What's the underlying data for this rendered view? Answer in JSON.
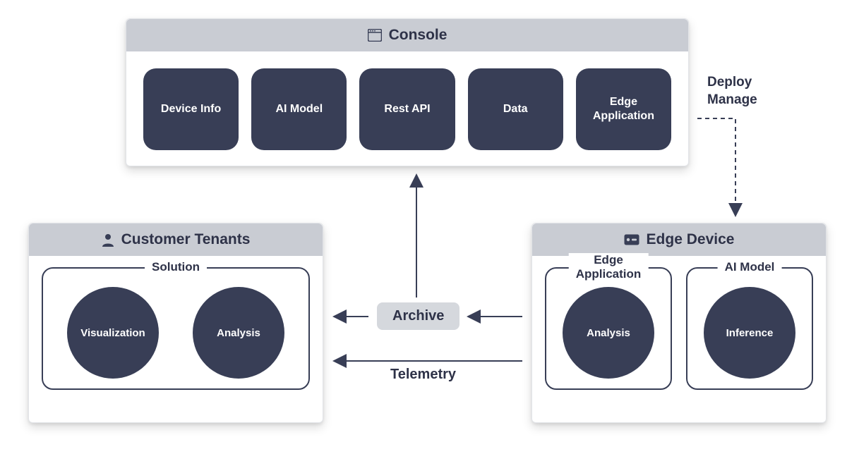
{
  "console": {
    "title": "Console",
    "tiles": {
      "device_info": "Device Info",
      "ai_model": "AI Model",
      "rest_api": "Rest API",
      "data": "Data",
      "edge_app": "Edge\nApplication"
    }
  },
  "tenants": {
    "title": "Customer Tenants",
    "group_label": "Solution",
    "circles": {
      "visualization": "Visualization",
      "analysis": "Analysis"
    }
  },
  "edge": {
    "title": "Edge Device",
    "groups": {
      "app": {
        "label": "Edge\nApplication",
        "circle": "Analysis"
      },
      "model": {
        "label": "AI Model",
        "circle": "Inference"
      }
    }
  },
  "labels": {
    "archive": "Archive",
    "telemetry": "Telemetry",
    "deploy_manage": "Deploy\nManage"
  }
}
